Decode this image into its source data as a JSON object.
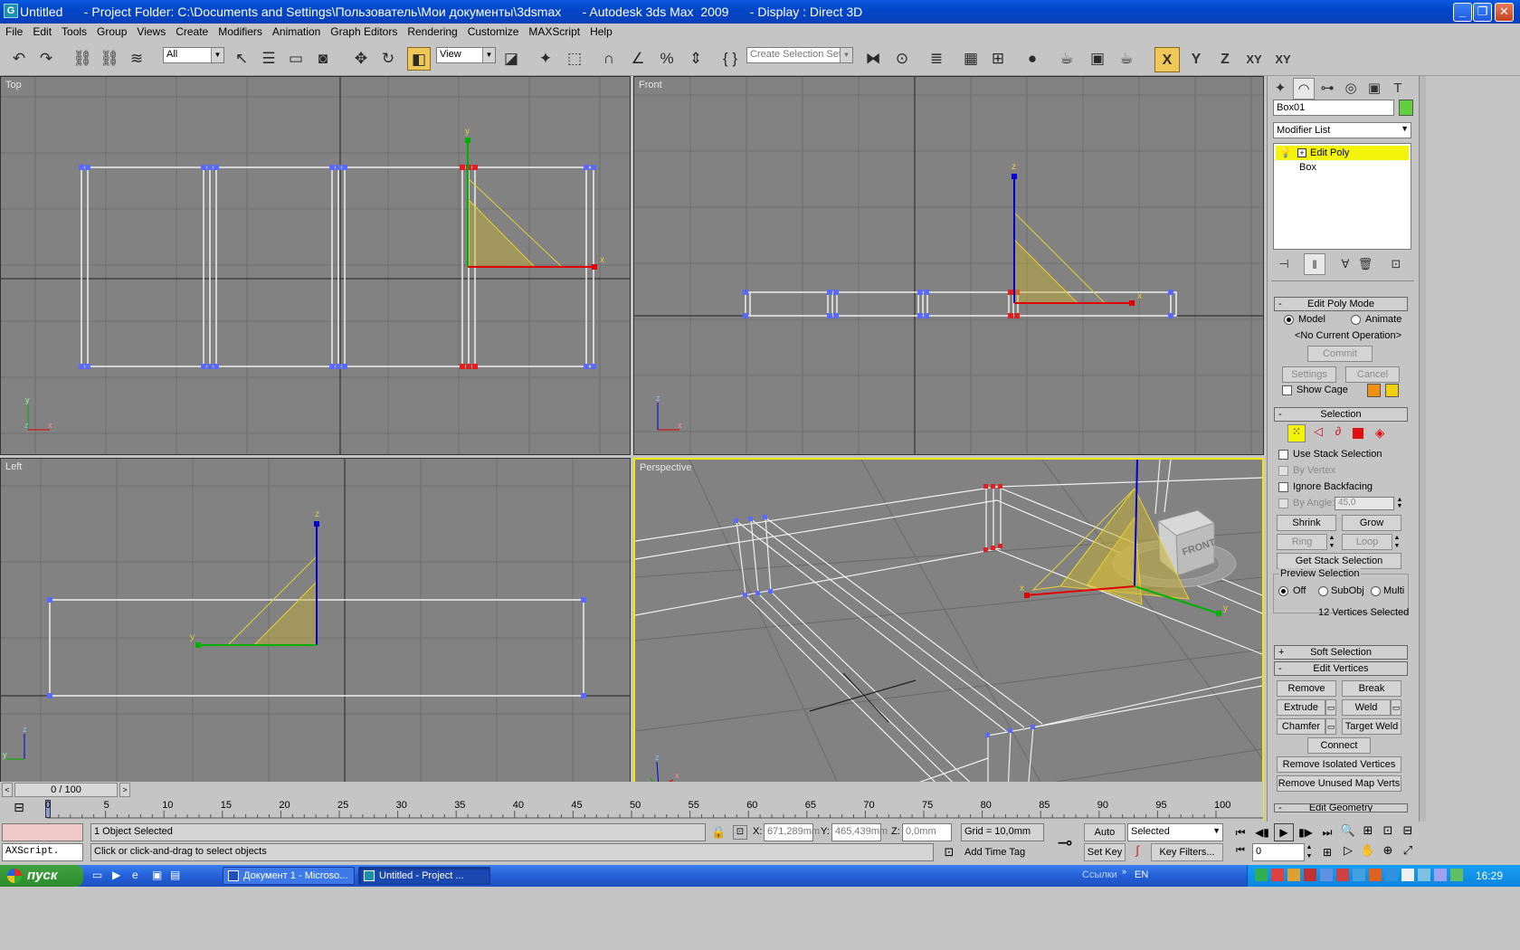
{
  "window": {
    "title": "Untitled      - Project Folder: C:\\Documents and Settings\\Пользователь\\Мои документы\\3dsmax      - Autodesk 3ds Max  2009      - Display : Direct 3D",
    "app_icon": "3ds-max-icon"
  },
  "menu": [
    "File",
    "Edit",
    "Tools",
    "Group",
    "Views",
    "Create",
    "Modifiers",
    "Animation",
    "Graph Editors",
    "Rendering",
    "Customize",
    "MAXScript",
    "Help"
  ],
  "toolbar": {
    "filter_value": "All",
    "coord_value": "View",
    "selection_set_placeholder": "Create Selection Set",
    "axis": [
      "X",
      "Y",
      "Z",
      "XY",
      "XY"
    ]
  },
  "viewports": {
    "top": "Top",
    "front": "Front",
    "left": "Left",
    "perspective": "Perspective"
  },
  "gizmo": {
    "x": "x",
    "y": "y",
    "z": "z"
  },
  "viewcube_label": "FRONT",
  "command_panel": {
    "object_name": "Box01",
    "object_color": "#62d03c",
    "modifier_list": "Modifier List",
    "stack": [
      "Edit Poly",
      "Box"
    ],
    "edit_poly_mode": {
      "title": "Edit Poly Mode",
      "model": "Model",
      "animate": "Animate",
      "operation": "<No Current Operation>",
      "commit": "Commit",
      "settings": "Settings",
      "cancel": "Cancel",
      "show_cage": "Show Cage"
    },
    "selection": {
      "title": "Selection",
      "use_stack": "Use Stack Selection",
      "by_vertex": "By Vertex",
      "ignore_backfacing": "Ignore Backfacing",
      "by_angle": "By Angle:",
      "angle_value": "45,0",
      "shrink": "Shrink",
      "grow": "Grow",
      "ring": "Ring",
      "loop": "Loop",
      "get_stack": "Get Stack Selection",
      "preview": "Preview Selection",
      "off": "Off",
      "subobj": "SubObj",
      "multi": "Multi",
      "count": "12 Vertices Selected"
    },
    "soft_selection": "Soft Selection",
    "edit_vertices": {
      "title": "Edit Vertices",
      "remove": "Remove",
      "break": "Break",
      "extrude": "Extrude",
      "weld": "Weld",
      "chamfer": "Chamfer",
      "target_weld": "Target Weld",
      "connect": "Connect",
      "remove_isolated": "Remove Isolated Vertices",
      "remove_unused": "Remove Unused Map Verts"
    },
    "edit_geometry": "Edit Geometry"
  },
  "timeline": {
    "frame": "0 / 100",
    "ticks": [
      "0",
      "5",
      "10",
      "15",
      "20",
      "25",
      "30",
      "35",
      "40",
      "45",
      "50",
      "55",
      "60",
      "65",
      "70",
      "75",
      "80",
      "85",
      "90",
      "95",
      "100"
    ]
  },
  "status": {
    "maxscript": "AXScript.",
    "selected": "1 Object Selected",
    "prompt": "Click or click-and-drag to select objects",
    "x_label": "X:",
    "x_value": "671,289mm",
    "y_label": "Y:",
    "y_value": "465,439mm",
    "z_label": "Z:",
    "z_value": "0,0mm",
    "grid": "Grid = 10,0mm",
    "auto_key": "Auto Key",
    "set_key": "Set Key",
    "key_mode": "Selected",
    "key_filters": "Key Filters...",
    "add_time_tag": "Add Time Tag",
    "frame_value": "0"
  },
  "taskbar": {
    "start": "пуск",
    "tasks": [
      "Документ 1 - Microso...",
      "Untitled      - Project ..."
    ],
    "links": "Ссылки",
    "lang": "EN",
    "clock": "16:29"
  },
  "colors": {
    "active_viewport": "#f4e60a",
    "selected_stack": "#f4f40a",
    "vertex_sel": "#e02020",
    "vertex": "#5a6aff",
    "gizmo_x": "#e00000",
    "gizmo_y": "#00b000",
    "gizmo_z": "#0000d0",
    "plane": "#d8c030"
  }
}
